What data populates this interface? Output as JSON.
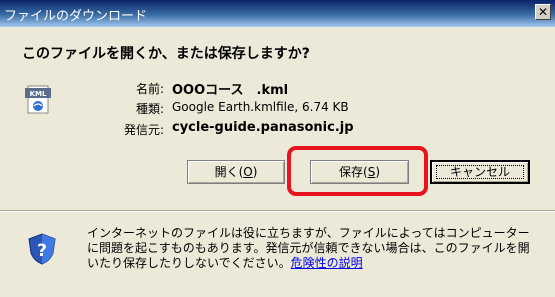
{
  "window": {
    "title": "ファイルのダウンロード",
    "close_label": "✕"
  },
  "dialog": {
    "question": "このファイルを開くか、または保存しますか?",
    "file_icon_label": "KML",
    "name_label": "名前:",
    "name_value": "OOOコース　.kml",
    "type_label": "種類:",
    "type_value": "Google Earth.kmlfile, 6.74 KB",
    "sender_label": "発信元:",
    "sender_value": "cycle-guide.panasonic.jp"
  },
  "buttons": {
    "open_label": "開く",
    "open_shortcut": "O",
    "save_label": "保存",
    "save_shortcut": "S",
    "cancel_label": "キャンセル"
  },
  "warning": {
    "text": "インターネットのファイルは役に立ちますが、ファイルによってはコンピューターに問題を起こすものもあります。発信元が信頼できない場合は、このファイルを開いたり保存したりしないでください。",
    "link_label": "危険性の説明"
  },
  "colors": {
    "highlight": "#e8141d",
    "titlebar": "#0a246a",
    "link": "#0000ee"
  }
}
